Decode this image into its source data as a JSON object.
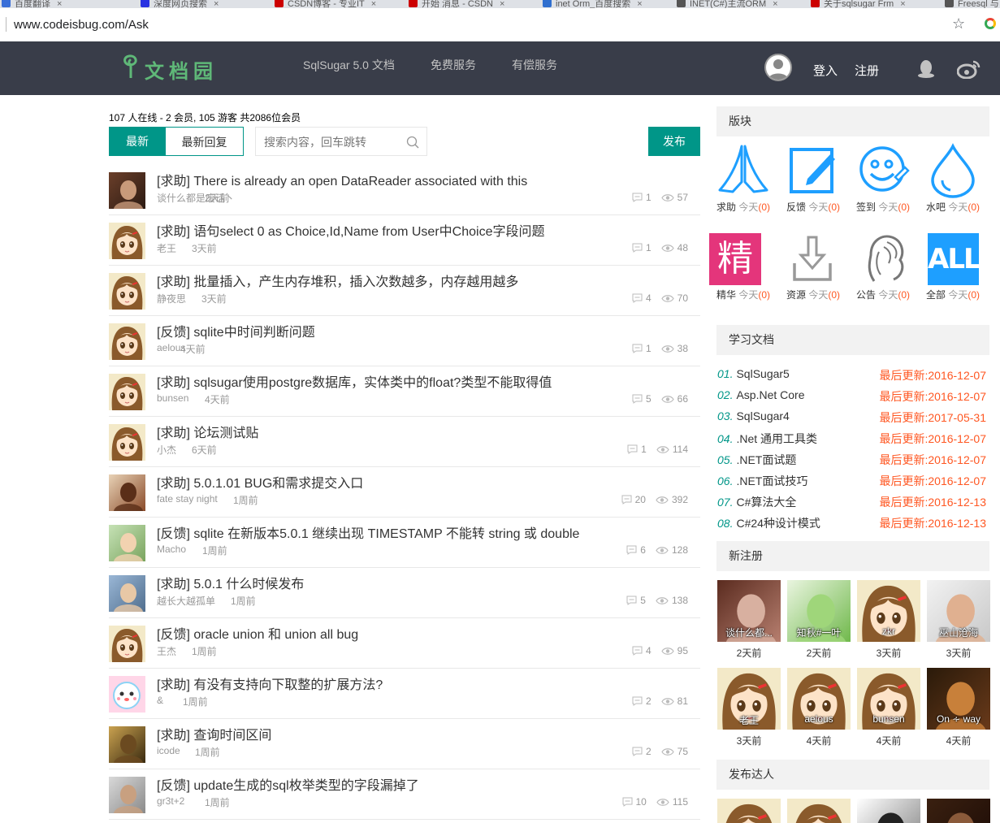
{
  "browser": {
    "tabs": [
      "百度翻译",
      "深度网页搜索",
      "CSDN博客 - 专业IT",
      "开始 消息 - CSDN",
      "inet Orm_百度搜索",
      "INET(C#)主流ORM",
      "关于sqlsugar Frm",
      "Freesql 与 sqlsug"
    ],
    "url": "www.codeisbug.com/Ask"
  },
  "header": {
    "logo_text": "文档园",
    "nav": [
      "SqlSugar 5.0 文档",
      "免费服务",
      "有偿服务"
    ],
    "login": "登入",
    "register": "注册"
  },
  "main": {
    "online_text": "107 人在线 - 2 会员, 105 游客 共2086位会员",
    "tab_latest": "最新",
    "tab_latest_reply": "最新回复",
    "search_placeholder": "搜索内容，回车跳转",
    "publish": "发布",
    "posts": [
      {
        "title": "[求助] There is already an open DataReader associated with this",
        "author": "谈什么都是废话丶",
        "time": "2天前",
        "comments": "1",
        "views": "57"
      },
      {
        "title": "[求助] 语句select 0 as Choice,Id,Name from User中Choice字段问题",
        "author": "老王",
        "time": "3天前",
        "comments": "1",
        "views": "48"
      },
      {
        "title": "[求助] 批量插入，产生内存堆积，插入次数越多，内存越用越多",
        "author": "静夜思",
        "time": "3天前",
        "comments": "4",
        "views": "70"
      },
      {
        "title": "[反馈] sqlite中时间判断问题",
        "author": "aelous",
        "time": "4天前",
        "comments": "1",
        "views": "38"
      },
      {
        "title": "[求助] sqlsugar使用postgre数据库，实体类中的float?类型不能取得值",
        "author": "bunsen",
        "time": "4天前",
        "comments": "5",
        "views": "66"
      },
      {
        "title": "[求助] 论坛测试贴",
        "author": "小杰",
        "time": "6天前",
        "comments": "1",
        "views": "114"
      },
      {
        "title": "[求助] 5.0.1.01 BUG和需求提交入口",
        "author": "fate stay night",
        "time": "1周前",
        "comments": "20",
        "views": "392"
      },
      {
        "title": "[反馈] sqlite 在新版本5.0.1 继续出现 TIMESTAMP 不能转 string 或 double",
        "author": "Macho",
        "time": "1周前",
        "comments": "6",
        "views": "128"
      },
      {
        "title": "[求助] 5.0.1 什么时候发布",
        "author": "越长大越孤单",
        "time": "1周前",
        "comments": "5",
        "views": "138"
      },
      {
        "title": "[反馈] oracle union 和 union all bug",
        "author": "王杰",
        "time": "1周前",
        "comments": "4",
        "views": "95"
      },
      {
        "title": "[求助] 有没有支持向下取整的扩展方法?",
        "author": "&",
        "time": "1周前",
        "comments": "2",
        "views": "81"
      },
      {
        "title": "[求助] 查询时间区间",
        "author": "icode",
        "time": "1周前",
        "comments": "2",
        "views": "75"
      },
      {
        "title": "[反馈] update生成的sql枚举类型的字段漏掉了",
        "author": "gr3t+2",
        "time": "1周前",
        "comments": "10",
        "views": "115"
      }
    ]
  },
  "sidebar": {
    "boards_title": "版块",
    "today_label": "今天",
    "boards": [
      {
        "name": "求助",
        "count": "(0)",
        "icon": "praying-hands-icon"
      },
      {
        "name": "反馈",
        "count": "(0)",
        "icon": "edit-square-icon"
      },
      {
        "name": "签到",
        "count": "(0)",
        "icon": "smiley-icon"
      },
      {
        "name": "水吧",
        "count": "(0)",
        "icon": "water-drop-icon"
      },
      {
        "name": "精华",
        "count": "(0)",
        "icon": "jing-badge-icon",
        "badge_text": "精"
      },
      {
        "name": "资源",
        "count": "(0)",
        "icon": "download-tray-icon"
      },
      {
        "name": "公告",
        "count": "(0)",
        "icon": "lady-profile-icon"
      },
      {
        "name": "全部",
        "count": "(0)",
        "icon": "all-badge-icon",
        "badge_text": "ALL"
      }
    ],
    "docs_title": "学习文档",
    "docs": [
      {
        "num": "01.",
        "name": "SqlSugar5",
        "updated": "最后更新:2016-12-07"
      },
      {
        "num": "02.",
        "name": "Asp.Net Core",
        "updated": "最后更新:2016-12-07"
      },
      {
        "num": "03.",
        "name": "SqlSugar4",
        "updated": "最后更新:2017-05-31"
      },
      {
        "num": "04.",
        "name": ".Net 通用工具类",
        "updated": "最后更新:2016-12-07"
      },
      {
        "num": "05.",
        "name": ".NET面试题",
        "updated": "最后更新:2016-12-07"
      },
      {
        "num": "06.",
        "name": ".NET面试技巧",
        "updated": "最后更新:2016-12-07"
      },
      {
        "num": "07.",
        "name": "C#算法大全",
        "updated": "最后更新:2016-12-13"
      },
      {
        "num": "08.",
        "name": "C#24种设计模式",
        "updated": "最后更新:2016-12-13"
      }
    ],
    "new_members_title": "新注册",
    "new_members": [
      {
        "name": "谈什么都...",
        "time": "2天前"
      },
      {
        "name": "知秋#一叶",
        "time": "2天前"
      },
      {
        "name": "zkr",
        "time": "3天前"
      },
      {
        "name": "巫山沧海",
        "time": "3天前"
      },
      {
        "name": "老王",
        "time": "3天前"
      },
      {
        "name": "aelous",
        "time": "4天前"
      },
      {
        "name": "bunsen",
        "time": "4天前"
      },
      {
        "name": "On ∻ way",
        "time": "4天前"
      }
    ],
    "top_posters_title": "发布达人"
  },
  "colors": {
    "accent": "#009688",
    "header_bg": "#393d49",
    "orange": "#ff5722"
  }
}
